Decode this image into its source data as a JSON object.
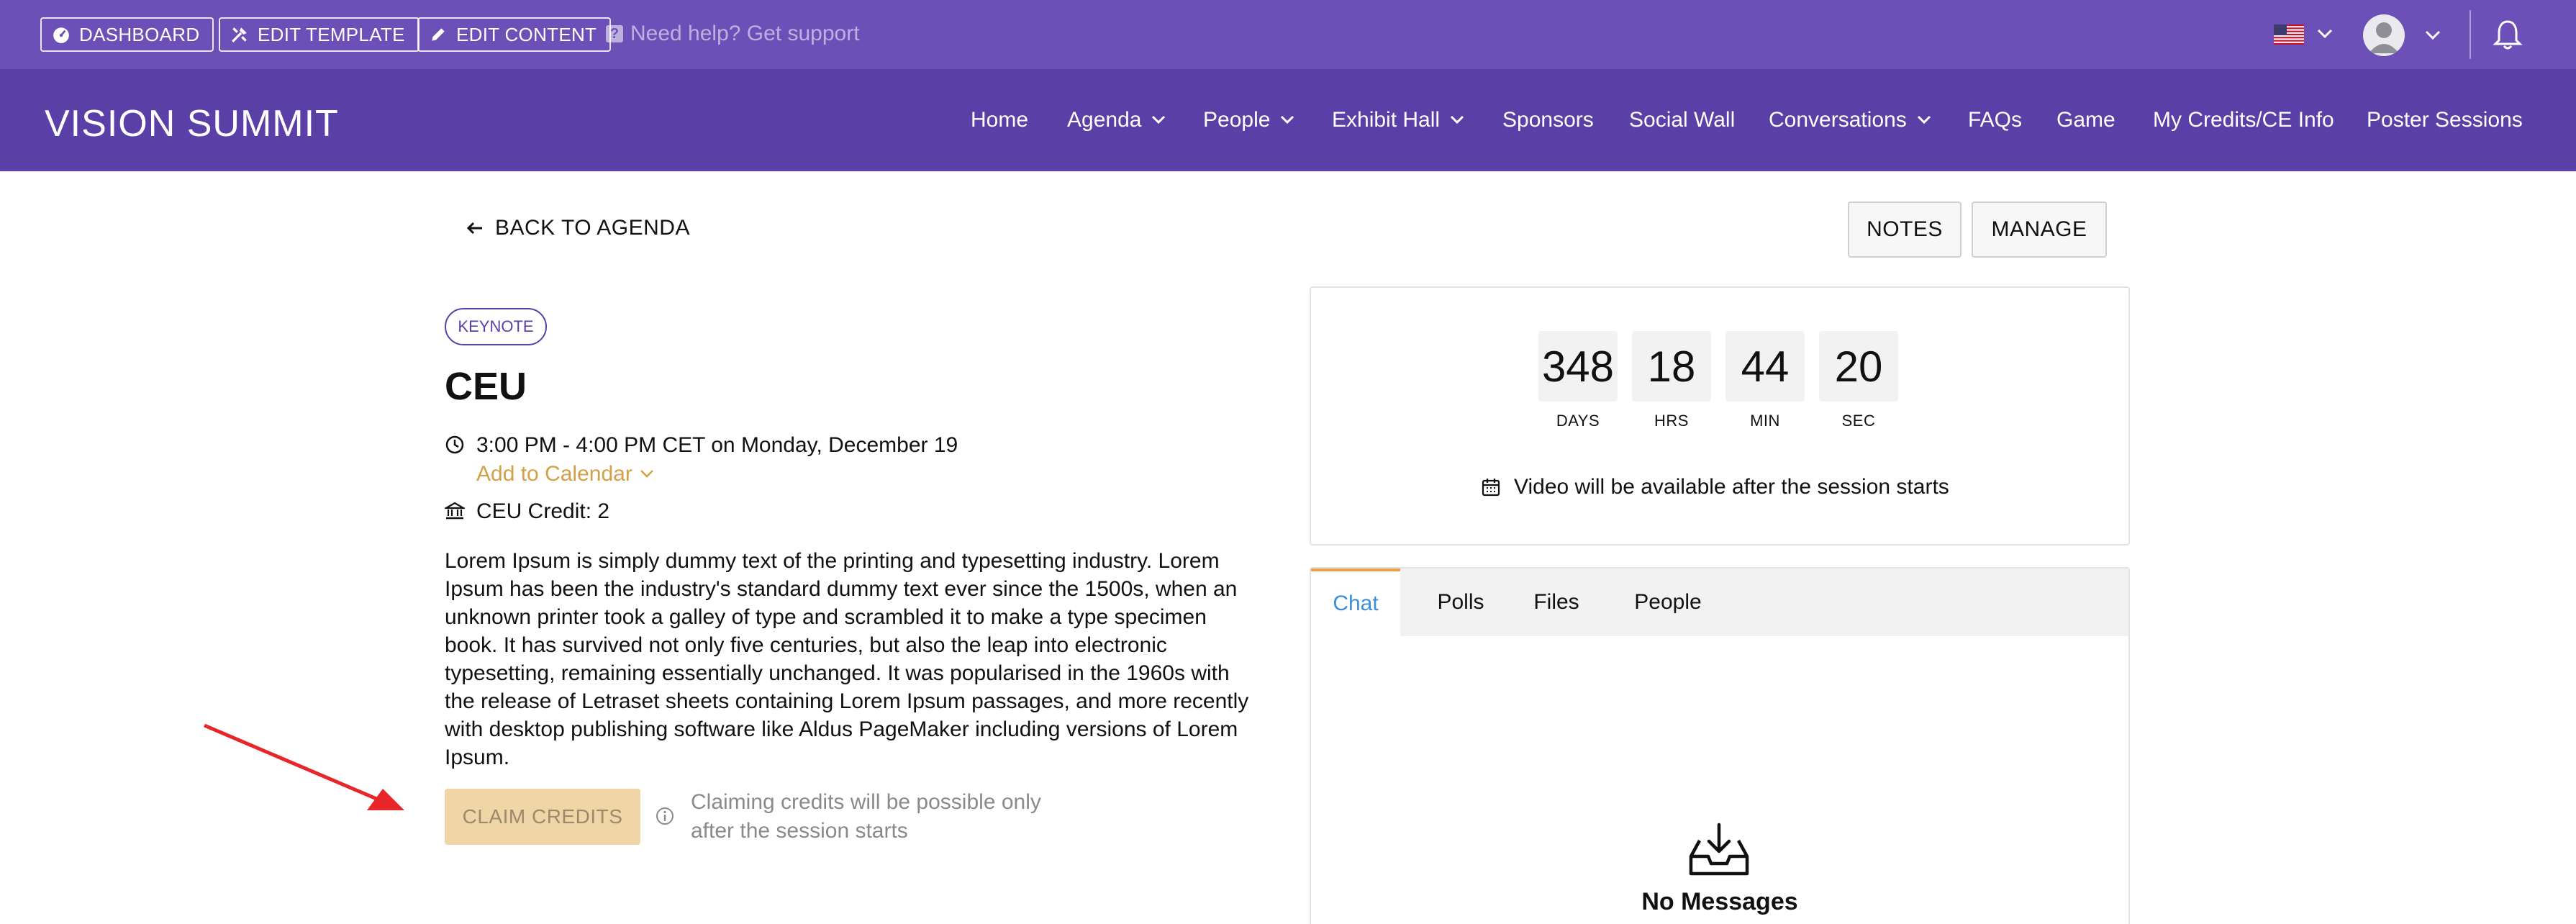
{
  "admin_bar": {
    "dashboard_label": "DASHBOARD",
    "edit_template_label": "EDIT TEMPLATE",
    "edit_content_label": "EDIT CONTENT",
    "help_text": "Need help? Get support"
  },
  "nav": {
    "logo": "VISION SUMMIT",
    "items": [
      {
        "label": "Home"
      },
      {
        "label": "Agenda"
      },
      {
        "label": "People"
      },
      {
        "label": "Exhibit Hall"
      },
      {
        "label": "Sponsors"
      },
      {
        "label": "Social Wall"
      },
      {
        "label": "Conversations"
      },
      {
        "label": "FAQs"
      },
      {
        "label": "Game"
      },
      {
        "label": "My Credits/CE Info"
      },
      {
        "label": "Poster Sessions"
      }
    ]
  },
  "session": {
    "back_label": "BACK TO AGENDA",
    "notes_label": "NOTES",
    "manage_label": "MANAGE",
    "badge": "KEYNOTE",
    "title": "CEU",
    "time": "3:00 PM - 4:00 PM CET on Monday, December 19",
    "add_to_calendar": "Add to Calendar",
    "ceu_credit": "CEU Credit: 2",
    "description": "Lorem Ipsum is simply dummy text of the printing and typesetting industry. Lorem Ipsum has been the industry's standard dummy text ever since the 1500s, when an unknown printer took a galley of type and scrambled it to make a type specimen book. It has survived not only five centuries, but also the leap into electronic typesetting, remaining essentially unchanged. It was popularised in the 1960s with the release of Letraset sheets containing Lorem Ipsum passages, and more recently with desktop publishing software like Aldus PageMaker including versions of Lorem Ipsum.",
    "claim_label": "CLAIM CREDITS",
    "claim_note": "Claiming credits will be possible only after the session starts"
  },
  "countdown": {
    "days": "348",
    "days_label": "DAYS",
    "hrs": "18",
    "hrs_label": "HRS",
    "min": "44",
    "min_label": "MIN",
    "sec": "20",
    "sec_label": "SEC",
    "video_note": "Video will be available after the session starts"
  },
  "chat": {
    "tabs": [
      {
        "label": "Chat"
      },
      {
        "label": "Polls"
      },
      {
        "label": "Files"
      },
      {
        "label": "People"
      }
    ],
    "empty_text": "No Messages"
  },
  "colors": {
    "admin_bar": "#6c50b8",
    "nav_bar": "#5a3fa6",
    "accent_gold": "#d4a047",
    "claim_disabled": "#f0d6a6",
    "tab_active_text": "#3a8fd6",
    "arrow": "#e8262a"
  }
}
